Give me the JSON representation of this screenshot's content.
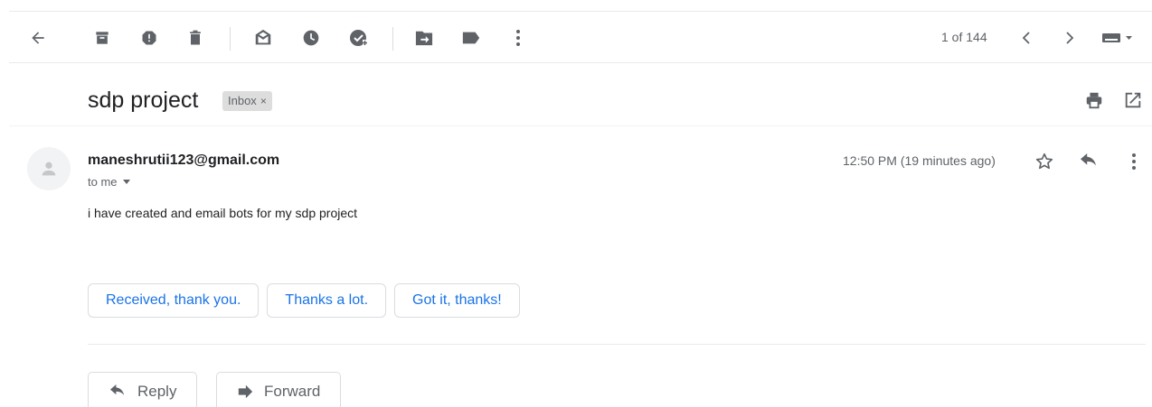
{
  "toolbar": {
    "icons": {
      "back": "arrow-left-icon",
      "archive": "archive-icon",
      "spam": "report-spam-icon",
      "delete": "trash-icon",
      "mark_unread": "mark-unread-icon",
      "snooze": "snooze-clock-icon",
      "add_task": "add-task-icon",
      "move_to": "move-to-folder-icon",
      "labels": "label-icon",
      "more": "more-vert-icon",
      "older": "chevron-left-icon",
      "newer": "chevron-right-icon",
      "input_tools": "keyboard-icon"
    },
    "pager": "1 of 144"
  },
  "thread": {
    "subject": "sdp project",
    "label_chip": "Inbox",
    "label_remove": "×",
    "print_icon": "print-icon",
    "new_window_icon": "open-in-new-icon"
  },
  "message": {
    "sender": "maneshrutii123@gmail.com",
    "recipient": "to me",
    "time": "12:50 PM (19 minutes ago)",
    "body": "i have created and email bots for my sdp project",
    "icons": {
      "avatar": "person-avatar-icon",
      "star": "star-outline-icon",
      "reply": "reply-icon",
      "more": "more-vert-icon"
    }
  },
  "smart_replies": [
    {
      "label": "Received, thank you."
    },
    {
      "label": "Thanks a lot."
    },
    {
      "label": "Got it, thanks!"
    }
  ],
  "actions": {
    "reply_label": "Reply",
    "forward_label": "Forward"
  },
  "colors": {
    "icon_gray": "#5f6368",
    "link_blue": "#1a73e8",
    "border": "#dadce0",
    "chip_bg": "#dddddd"
  }
}
